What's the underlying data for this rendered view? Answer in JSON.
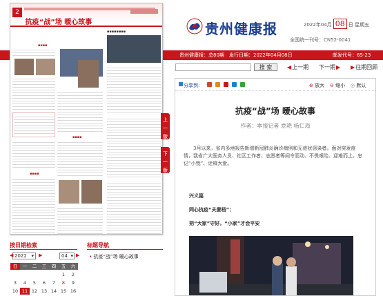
{
  "thumbnail": {
    "page_number": "2",
    "headline": "抗疫“战”场 暖心故事"
  },
  "header": {
    "logo_text": "贵州健康报",
    "date_prefix": "2022年04月",
    "date_day": "08",
    "date_suffix": "日 星期五",
    "issn": "全国统一刊号：CN52-0041"
  },
  "infobar": {
    "paper": "贵州健康报：总80期",
    "publish_date": "发行日期：2022年04月08日",
    "phone": "邮发代号：65-23"
  },
  "search": {
    "placeholder": "",
    "button_label": "搜 索",
    "prev_label": "上一期",
    "next_label": "下一期",
    "past_label": "往期回顾"
  },
  "article": {
    "share_label": "分享到:",
    "zoom_in": "放大",
    "zoom_out": "缩小",
    "default": "默认",
    "title": "抗疫“战”场 暖心故事",
    "meta": "作者：本报记者 龙艳 杨仁海",
    "body": "3月以来，省内多地报告新增新冠肺炎确诊病例和无症状感染者。面对突发疫情，我省广大医务人员、社区工作者、志愿者等闻令而动、不畏艰险、迎难而上，忠记“小我”、诠释大爱。",
    "section": "兴义篇",
    "subhead1": "同心抗疫“夫妻档”：",
    "subhead2": "把“大家”守好，“小家”才会平安"
  },
  "side_tabs": {
    "up": "上一版",
    "down": "下一版"
  },
  "calendar": {
    "title": "按日期检索",
    "year": "2022",
    "month": "04",
    "weekdays": [
      "日",
      "一",
      "二",
      "三",
      "四",
      "五",
      "六"
    ],
    "rows": [
      [
        "",
        "",
        "",
        "",
        "",
        "1",
        "2"
      ],
      [
        "3",
        "4",
        "5",
        "6",
        "7",
        "8",
        "9"
      ],
      [
        "10",
        "11",
        "12",
        "13",
        "14",
        "15",
        "16"
      ]
    ]
  },
  "title_nav": {
    "title": "标题导航",
    "item": "抗疫“战”场 暖心故事"
  },
  "colors": {
    "brand_red": "#c8161d",
    "logo_blue": "#1b3f91"
  }
}
